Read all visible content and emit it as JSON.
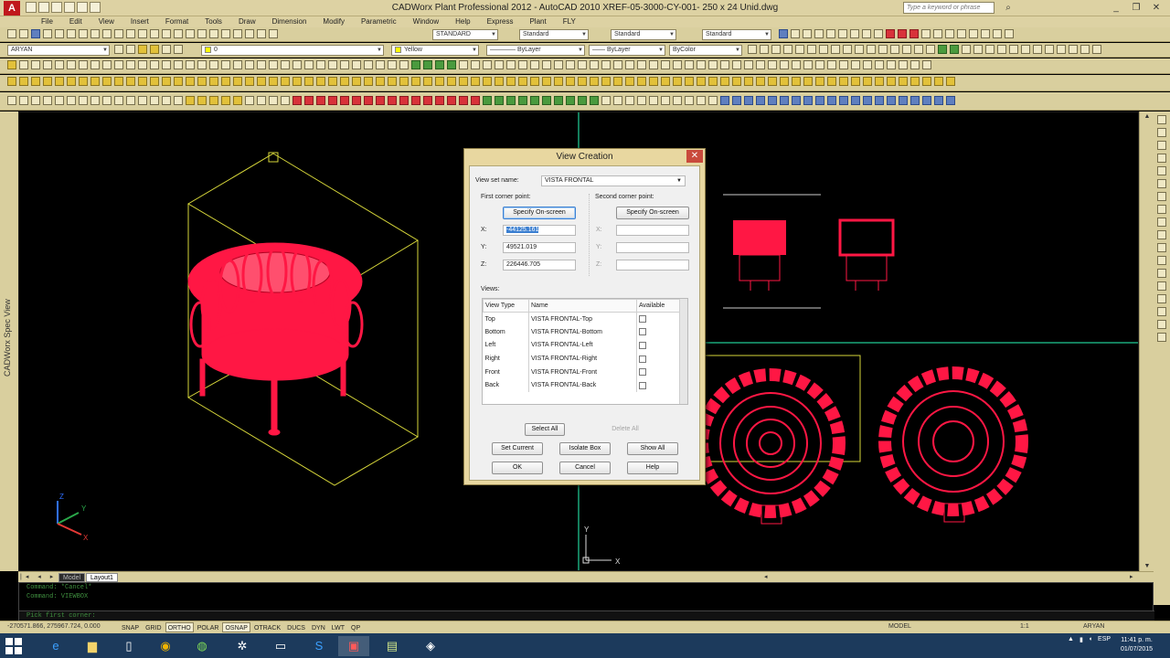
{
  "window": {
    "title": "CADWorx Plant Professional 2012 - AutoCAD 2010     XREF-05-3000-CY-001- 250 x 24 Unid.dwg",
    "search_placeholder": "Type a keyword or phrase",
    "app_logo_letter": "A"
  },
  "menu": [
    "File",
    "Edit",
    "View",
    "Insert",
    "Format",
    "Tools",
    "Draw",
    "Dimension",
    "Modify",
    "Parametric",
    "Window",
    "Help",
    "Express",
    "Plant",
    "FLY"
  ],
  "toolbars": {
    "textstyle_combo": "STANDARD",
    "dimstyle_combo": "Standard",
    "tablestyle_combo": "Standard",
    "mleaderstyle_combo": "Standard",
    "workspace_combo": "ARYAN",
    "layer_combo": "0",
    "color_combo": "Yellow",
    "linetype_combo": "ByLayer",
    "lineweight_combo": "ByLayer",
    "plotstyle_combo": "ByColor"
  },
  "left_palette_label": "CADWorx Spec View",
  "layout_tabs": [
    "Model",
    "Layout1"
  ],
  "command_history": [
    "Command: *Cancel*",
    "Command: VIEWBOX"
  ],
  "command_prompt": "Pick first corner:",
  "status_bar": {
    "coordinates": "-270571.866, 275967.724, 0.000",
    "modes": [
      {
        "label": "SNAP",
        "on": false
      },
      {
        "label": "GRID",
        "on": false
      },
      {
        "label": "ORTHO",
        "on": true
      },
      {
        "label": "POLAR",
        "on": false
      },
      {
        "label": "OSNAP",
        "on": true
      },
      {
        "label": "OTRACK",
        "on": false
      },
      {
        "label": "DUCS",
        "on": false
      },
      {
        "label": "DYN",
        "on": false
      },
      {
        "label": "LWT",
        "on": false
      },
      {
        "label": "QP",
        "on": false
      }
    ],
    "model_label": "MODEL",
    "scale_label": "1:1",
    "user_label": "ARYAN"
  },
  "taskbar": {
    "language": "ESP",
    "time": "11:41 p. m.",
    "date": "01/07/2015"
  },
  "dialog": {
    "title": "View Creation",
    "view_set_label": "View set name:",
    "view_set_value": "VISTA FRONTAL",
    "first_corner_label": "First corner point:",
    "second_corner_label": "Second corner point:",
    "specify_onscreen_label": "Specify On-screen",
    "x_label": "X:",
    "y_label": "Y:",
    "z_label": "Z:",
    "first_x": "-44125.161",
    "first_y": "49521.019",
    "first_z": "226446.705",
    "views_label": "Views:",
    "table_headers": [
      "View Type",
      "Name",
      "Available"
    ],
    "views": [
      {
        "type": "Top",
        "name": "VISTA FRONTAL-Top"
      },
      {
        "type": "Bottom",
        "name": "VISTA FRONTAL-Bottom"
      },
      {
        "type": "Left",
        "name": "VISTA FRONTAL-Left"
      },
      {
        "type": "Right",
        "name": "VISTA FRONTAL-Right"
      },
      {
        "type": "Front",
        "name": "VISTA FRONTAL-Front"
      },
      {
        "type": "Back",
        "name": "VISTA FRONTAL-Back"
      }
    ],
    "buttons": {
      "select_all": "Select All",
      "delete_all": "Delete All",
      "set_current": "Set Current",
      "isolate_box": "Isolate Box",
      "show_all": "Show All",
      "ok": "OK",
      "cancel": "Cancel",
      "help": "Help"
    }
  },
  "ucs_icon": {
    "x": "X",
    "y": "Y",
    "z": "Z"
  },
  "colors": {
    "model": "#ff1744",
    "viewbox": "#d6d63a",
    "viewport_border": "#1aa87a",
    "background": "#000000"
  }
}
